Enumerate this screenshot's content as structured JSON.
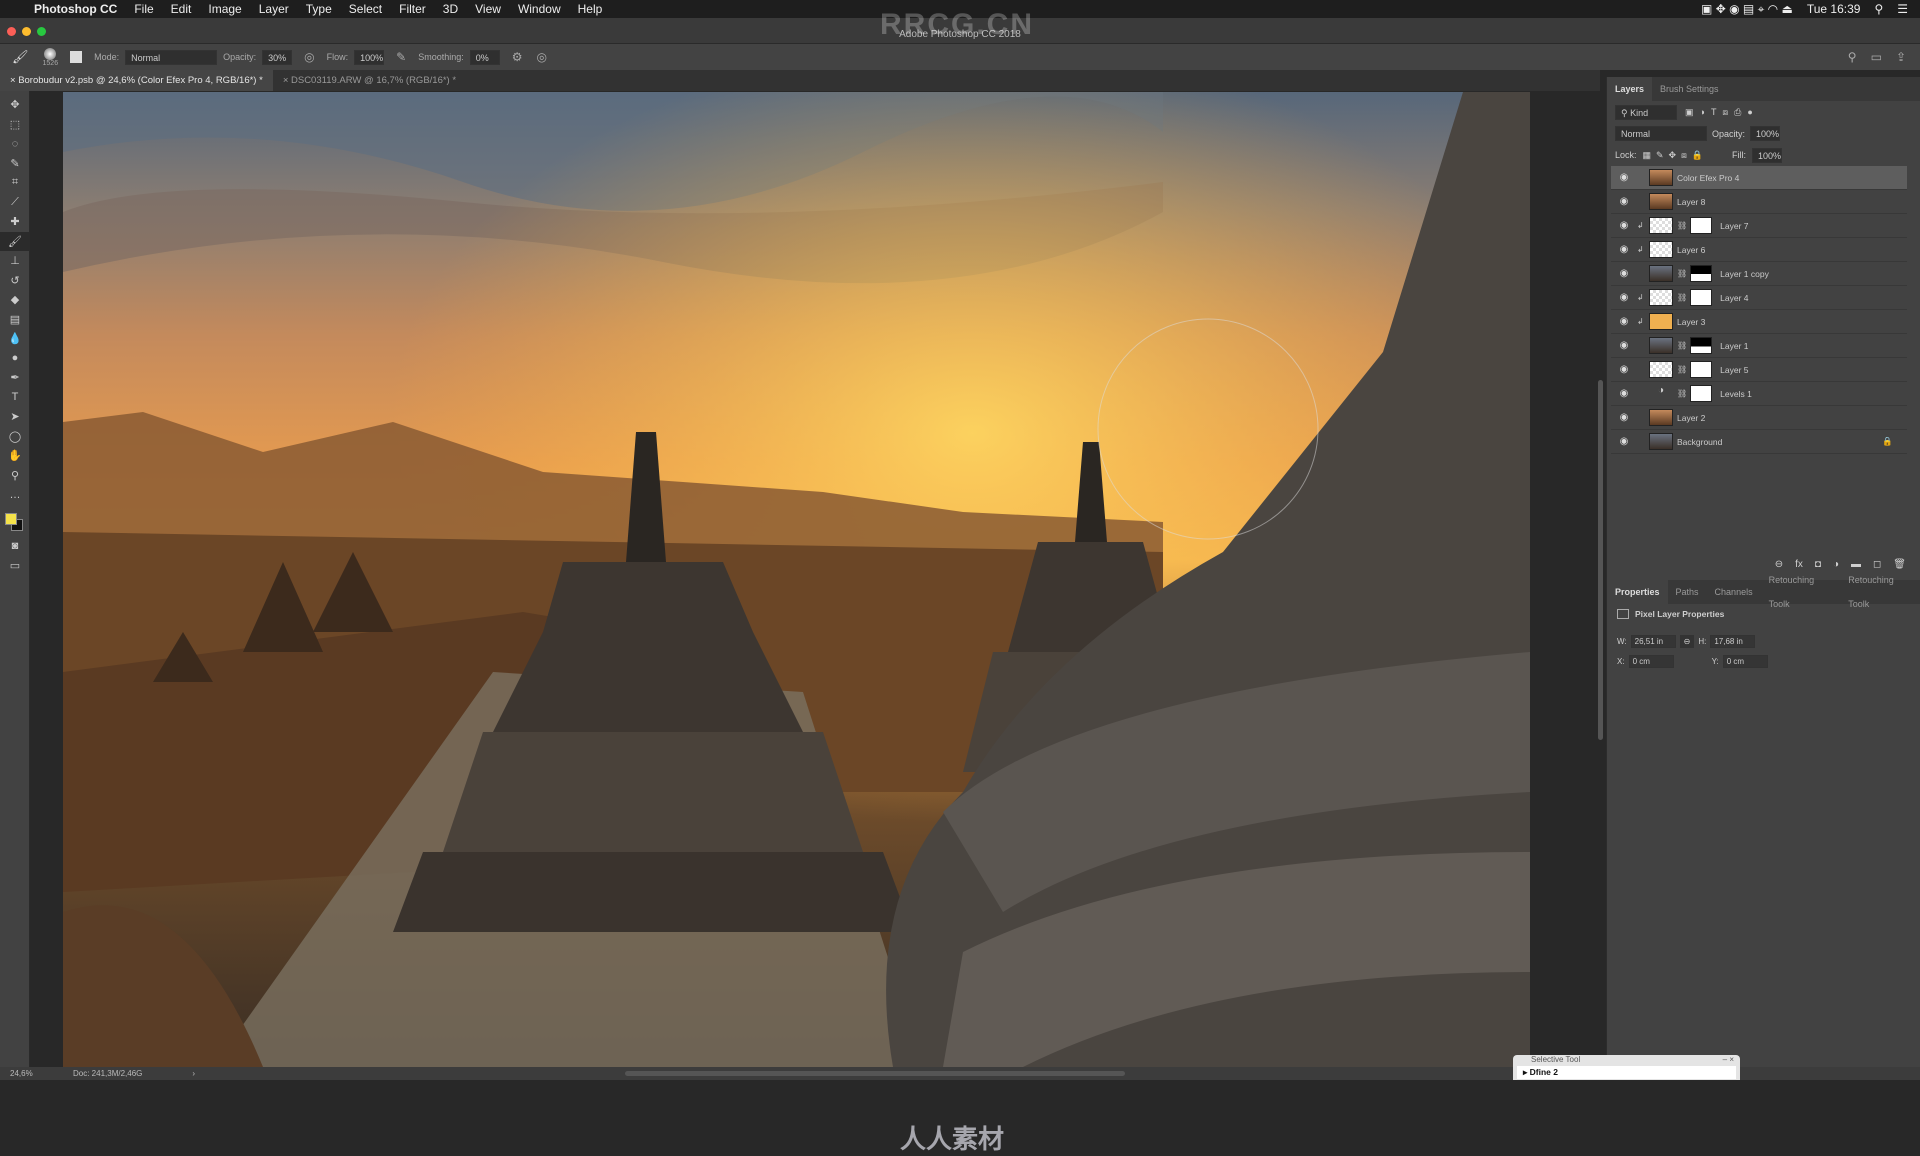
{
  "menubar": {
    "app": "Photoshop CC",
    "items": [
      "File",
      "Edit",
      "Image",
      "Layer",
      "Type",
      "Select",
      "Filter",
      "3D",
      "View",
      "Window",
      "Help"
    ],
    "clock": "Tue 16:39"
  },
  "window": {
    "title": "Adobe Photoshop CC 2018",
    "watermark": "RRCG.CN"
  },
  "options": {
    "brush_size": "1526",
    "mode_label": "Mode:",
    "mode": "Normal",
    "opacity_label": "Opacity:",
    "opacity": "30%",
    "flow_label": "Flow:",
    "flow": "100%",
    "smoothing_label": "Smoothing:",
    "smoothing": "0%"
  },
  "tabs": [
    {
      "label": "Borobudur v2.psb @ 24,6% (Color Efex Pro 4, RGB/16*) *",
      "active": true
    },
    {
      "label": "DSC03119.ARW @ 16,7% (RGB/16*) *",
      "active": false
    }
  ],
  "tools": [
    "move",
    "marquee",
    "lasso",
    "quick-select",
    "crop",
    "eyedropper",
    "healing",
    "brush",
    "stamp",
    "history-brush",
    "eraser",
    "gradient",
    "blur",
    "dodge",
    "pen",
    "type",
    "path-select",
    "shape",
    "hand",
    "zoom",
    "more"
  ],
  "colors": {
    "foreground": "#f4e24a",
    "background": "#111111",
    "accent": "#5e5e5e"
  },
  "layers_panel": {
    "tabs": [
      "Layers",
      "Brush Settings"
    ],
    "filter": "Kind",
    "blend": "Normal",
    "opacity_label": "Opacity:",
    "opacity": "100%",
    "lock_label": "Lock:",
    "fill_label": "Fill:",
    "fill": "100%",
    "layers": [
      {
        "name": "Color Efex Pro 4",
        "thumb": "photo",
        "selected": true
      },
      {
        "name": "Layer 8",
        "thumb": "photo"
      },
      {
        "name": "Layer 7",
        "thumb": "transparent",
        "clip": true,
        "mask": true
      },
      {
        "name": "Layer 6",
        "thumb": "transparent",
        "clip": true
      },
      {
        "name": "Layer 1 copy",
        "thumb": "photo-dark",
        "mask": "black"
      },
      {
        "name": "Layer 4",
        "thumb": "transparent",
        "clip": true,
        "mask": true
      },
      {
        "name": "Layer 3",
        "thumb": "orange",
        "clip": true
      },
      {
        "name": "Layer 1",
        "thumb": "photo-dark",
        "mask": "black"
      },
      {
        "name": "Layer 5",
        "thumb": "transparent",
        "mask": true
      },
      {
        "name": "Levels 1",
        "thumb": "adjustment",
        "mask": true
      },
      {
        "name": "Layer 2",
        "thumb": "photo"
      },
      {
        "name": "Background",
        "thumb": "photo-dark",
        "locked": true
      }
    ]
  },
  "properties_panel": {
    "tabs": [
      "Properties",
      "Paths",
      "Channels",
      "Retouching Toolk",
      "Retouching Toolk"
    ],
    "title": "Pixel Layer Properties",
    "w_label": "W:",
    "w": "26,51 in",
    "h_label": "H:",
    "h": "17,68 in",
    "x_label": "X:",
    "x": "0 cm",
    "y_label": "Y:",
    "y": "0 cm"
  },
  "status": {
    "zoom": "24,6%",
    "doc": "Doc: 241,3M/2,46G"
  },
  "selective_tool": {
    "title": "Selective Tool",
    "item": "Dfine 2"
  },
  "bottom_logo": "人人素材"
}
